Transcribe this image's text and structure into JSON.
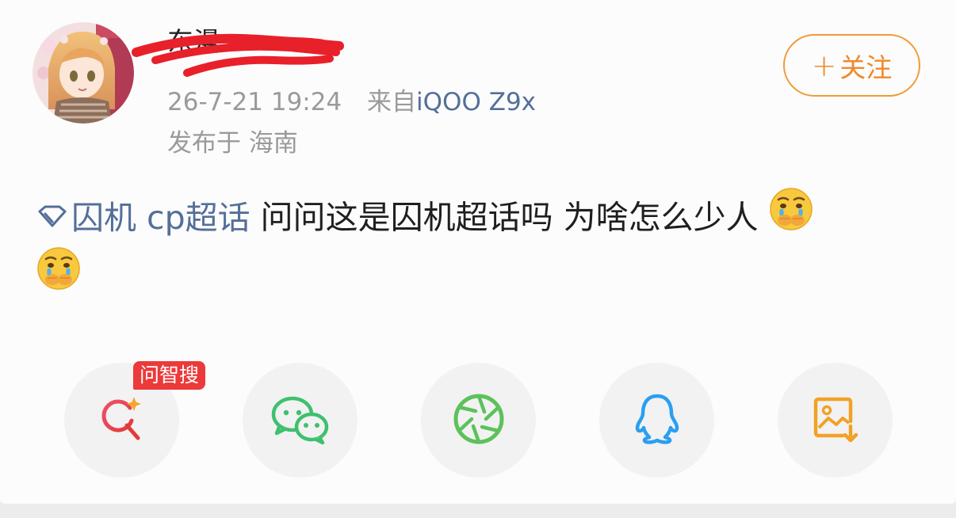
{
  "post": {
    "username": "东漫…",
    "timestamp": "26-7-21 19:24",
    "source_prefix": "来自",
    "device": "iQOO Z9x",
    "location": "发布于 海南",
    "follow_label": "关注",
    "follow_plus": "+",
    "topic_label": "囚机 cp超话",
    "body_text": " 问问这是囚机超话吗 为啥怎么少人"
  },
  "share": {
    "badge_label": "问智搜",
    "items": [
      {
        "name": "ai-search",
        "icon": "search-sparkle-icon",
        "color": "#e8404f"
      },
      {
        "name": "wechat",
        "icon": "wechat-icon",
        "color": "#3fc06f"
      },
      {
        "name": "moments",
        "icon": "aperture-icon",
        "color": "#5cc25a"
      },
      {
        "name": "qq",
        "icon": "penguin-icon",
        "color": "#2a9ff0"
      },
      {
        "name": "save-image",
        "icon": "image-download-icon",
        "color": "#f2a126"
      }
    ]
  },
  "colors": {
    "link": "#546f98",
    "accent": "#f0892a",
    "badge": "#ec3a3a"
  }
}
